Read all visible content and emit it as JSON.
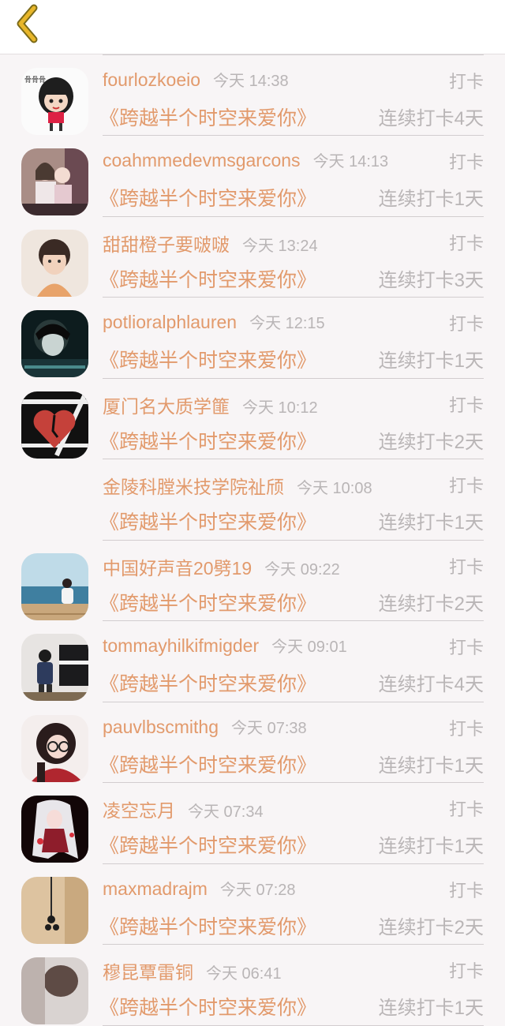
{
  "header": {
    "back_icon": "chevron-left-icon",
    "accent": "#e8b62a"
  },
  "colors": {
    "name": "#e29a6c",
    "meta": "#b9b5b6",
    "divider": "#d2cdcf"
  },
  "entries": [
    {
      "name": "",
      "time": "",
      "checkin": "",
      "book": "",
      "streak": "",
      "avatar": "none"
    },
    {
      "name": "fourlozkoeio",
      "time": "今天 14:38",
      "checkin": "打卡",
      "book": "《跨越半个时空来爱你》",
      "streak": "连续打卡4天",
      "avatar": "cartoon-girl"
    },
    {
      "name": "coahmmedevmsgarcons",
      "time": "今天 14:13",
      "checkin": "打卡",
      "book": "《跨越半个时空来爱你》",
      "streak": "连续打卡1天",
      "avatar": "two-girls"
    },
    {
      "name": "甜甜橙子要啵啵",
      "time": "今天 13:24",
      "checkin": "打卡",
      "book": "《跨越半个时空来爱你》",
      "streak": "连续打卡3天",
      "avatar": "boy-portrait"
    },
    {
      "name": "potlioralphlauren",
      "time": "今天 12:15",
      "checkin": "打卡",
      "book": "《跨越半个时空来爱你》",
      "streak": "连续打卡1天",
      "avatar": "dark-portrait"
    },
    {
      "name": "厦门名大质学篚",
      "time": "今天 10:12",
      "checkin": "打卡",
      "book": "《跨越半个时空来爱你》",
      "streak": "连续打卡2天",
      "avatar": "red-heart"
    },
    {
      "name": "金陵科膛米技学院祉颀",
      "time": "今天 10:08",
      "checkin": "打卡",
      "book": "《跨越半个时空来爱你》",
      "streak": "连续打卡1天",
      "avatar": "none"
    },
    {
      "name": "中国好声音20劈19",
      "time": "今天 09:22",
      "checkin": "打卡",
      "book": "《跨越半个时空来爱你》",
      "streak": "连续打卡2天",
      "avatar": "seaside-girl"
    },
    {
      "name": "tommayhilkifmigder",
      "time": "今天 09:01",
      "checkin": "打卡",
      "book": "《跨越半个时空来爱你》",
      "streak": "连续打卡4天",
      "avatar": "piano-boy"
    },
    {
      "name": "pauvlbscmithg",
      "time": "今天 07:38",
      "checkin": "打卡",
      "book": "《跨越半个时空来爱你》",
      "streak": "连续打卡1天",
      "avatar": "glasses-girl"
    },
    {
      "name": "凌空忘月",
      "time": "今天 07:34",
      "checkin": "打卡",
      "book": "《跨越半个时空来爱你》",
      "streak": "连续打卡1天",
      "avatar": "anime-girl"
    },
    {
      "name": "maxmadrajm",
      "time": "今天 07:28",
      "checkin": "打卡",
      "book": "《跨越半个时空来爱你》",
      "streak": "连续打卡2天",
      "avatar": "beige-earphones"
    },
    {
      "name": "穆昆覃雷铜",
      "time": "今天 06:41",
      "checkin": "打卡",
      "book": "《跨越半个时空来爱你》",
      "streak": "连续打卡1天",
      "avatar": "partial-photo"
    }
  ]
}
